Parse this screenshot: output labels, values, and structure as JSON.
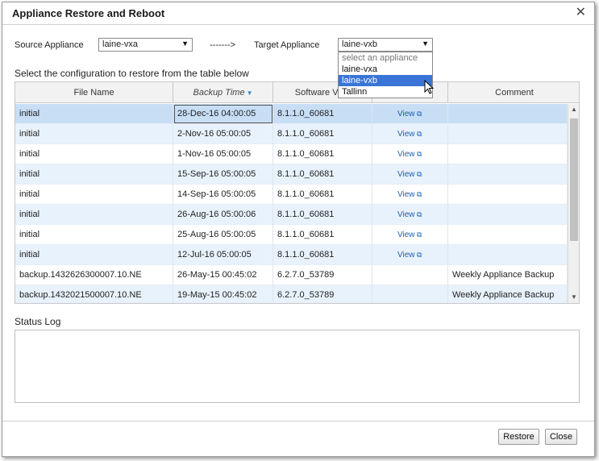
{
  "dialog": {
    "title": "Appliance Restore and Reboot"
  },
  "source": {
    "label": "Source Appliance",
    "value": "laine-vxa"
  },
  "arrow_text": "------->",
  "target": {
    "label": "Target Appliance",
    "value": "laine-vxb",
    "options": [
      "select an appliance",
      "laine-vxa",
      "laine-vxb",
      "Tallinn"
    ],
    "highlighted": "laine-vxb"
  },
  "instruction": "Select the configuration to restore from the table below",
  "table": {
    "columns": [
      "File Name",
      "Backup Time",
      "Software Vers",
      "",
      "Comment"
    ],
    "sorted_column": "Backup Time",
    "rows": [
      {
        "file": "initial",
        "time": "28-Dec-16 04:00:05",
        "version": "8.1.1.0_60681",
        "view": "View",
        "comment": ""
      },
      {
        "file": "initial",
        "time": "2-Nov-16 05:00:05",
        "version": "8.1.1.0_60681",
        "view": "View",
        "comment": ""
      },
      {
        "file": "initial",
        "time": "1-Nov-16 05:00:05",
        "version": "8.1.1.0_60681",
        "view": "View",
        "comment": ""
      },
      {
        "file": "initial",
        "time": "15-Sep-16 05:00:05",
        "version": "8.1.1.0_60681",
        "view": "View",
        "comment": ""
      },
      {
        "file": "initial",
        "time": "14-Sep-16 05:00:05",
        "version": "8.1.1.0_60681",
        "view": "View",
        "comment": ""
      },
      {
        "file": "initial",
        "time": "26-Aug-16 05:00:06",
        "version": "8.1.1.0_60681",
        "view": "View",
        "comment": ""
      },
      {
        "file": "initial",
        "time": "25-Aug-16 05:00:05",
        "version": "8.1.1.0_60681",
        "view": "View",
        "comment": ""
      },
      {
        "file": "initial",
        "time": "12-Jul-16 05:00:05",
        "version": "8.1.1.0_60681",
        "view": "View",
        "comment": ""
      },
      {
        "file": "backup.1432626300007.10.NE",
        "time": "26-May-15 00:45:02",
        "version": "6.2.7.0_53789",
        "view": "",
        "comment": "Weekly Appliance Backup"
      },
      {
        "file": "backup.1432021500007.10.NE",
        "time": "19-May-15 00:45:02",
        "version": "6.2.7.0_53789",
        "view": "",
        "comment": "Weekly Appliance Backup"
      }
    ]
  },
  "status_log": {
    "label": "Status Log",
    "content": ""
  },
  "buttons": {
    "restore": "Restore",
    "close": "Close"
  },
  "colors": {
    "selection": "#3875d7",
    "row_alt": "#e8f2fc",
    "row_selected": "#c7def5",
    "link": "#1a5fb4"
  }
}
